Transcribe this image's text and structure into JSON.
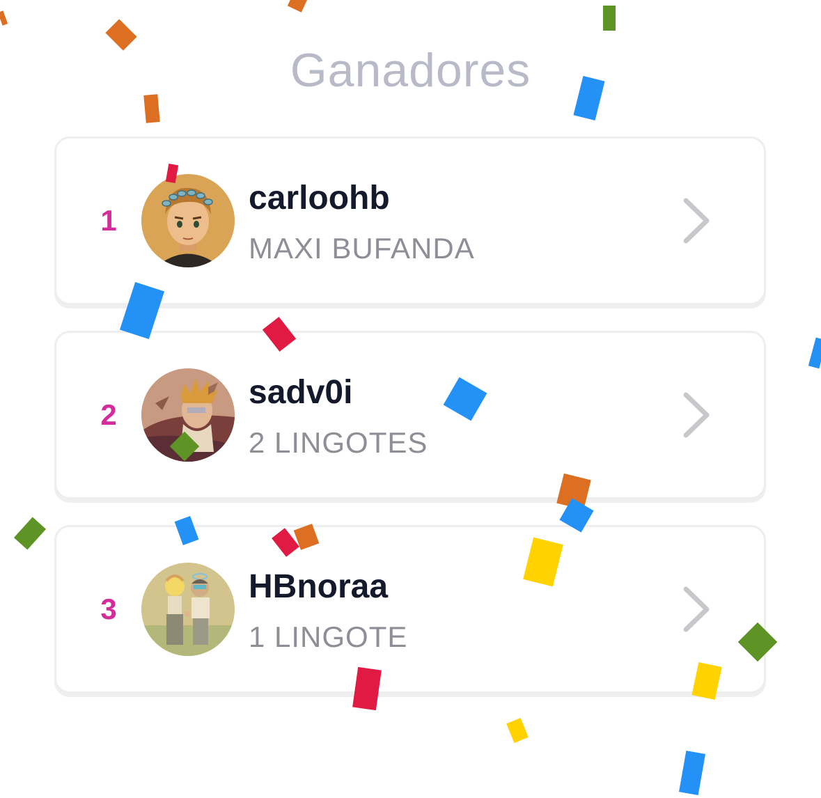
{
  "header": {
    "title": "Ganadores"
  },
  "winners": [
    {
      "rank": "1",
      "username": "carloohb",
      "prize": "MAXI BUFANDA",
      "avatar_icon": "avatar-laurel-wreath-boy"
    },
    {
      "rank": "2",
      "username": "sadv0i",
      "prize": "2 LINGOTES",
      "avatar_icon": "avatar-spiky-hair-character"
    },
    {
      "rank": "3",
      "username": "HBnoraa",
      "prize": "1 LINGOTE",
      "avatar_icon": "avatar-couple-holding-hands"
    }
  ],
  "colors": {
    "title": "#b9bac8",
    "rank": "#d42c9a",
    "username": "#141a2b",
    "prize": "#8d8e96",
    "chevron": "#c8c8cc",
    "card_border": "#eeeeef",
    "confetti_orange": "#dc6f22",
    "confetti_blue": "#2391f5",
    "confetti_red": "#e01a43",
    "confetti_green": "#5e9426",
    "confetti_yellow": "#ffd200"
  }
}
